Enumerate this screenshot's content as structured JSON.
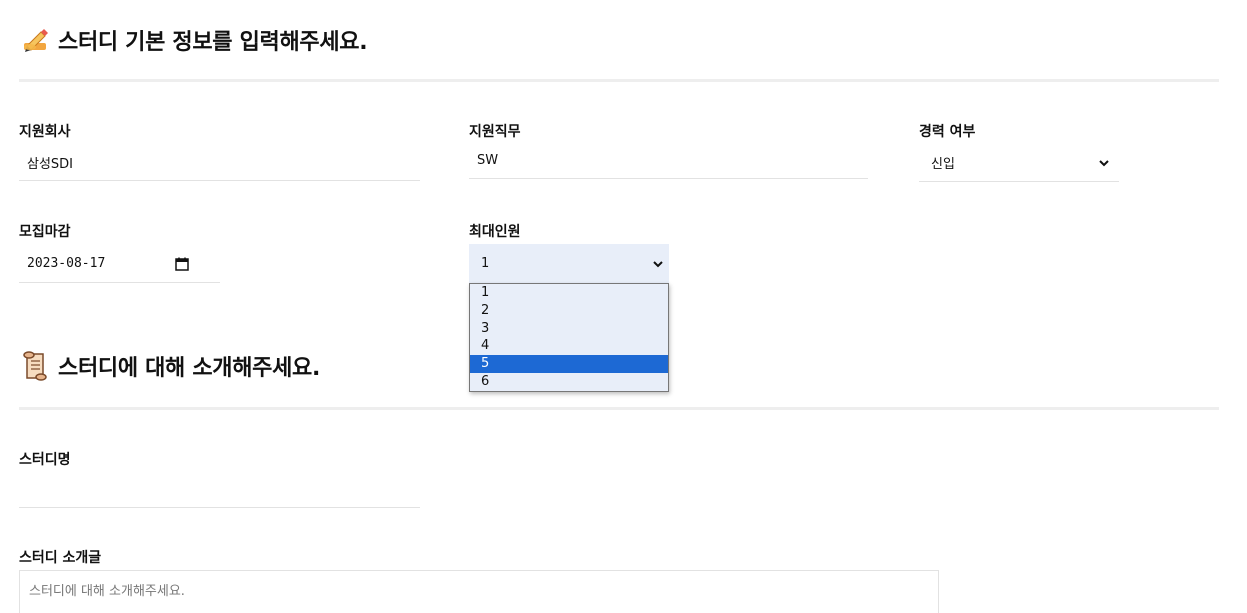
{
  "sections": {
    "basic": {
      "emoji": "✍️",
      "title": "스터디 기본 정보를 입력해주세요."
    },
    "intro": {
      "emoji": "📜",
      "title": "스터디에 대해 소개해주세요."
    }
  },
  "fields": {
    "company": {
      "label": "지원회사",
      "value": "삼성SDI"
    },
    "job": {
      "label": "지원직무",
      "value": "SW"
    },
    "career": {
      "label": "경력 여부",
      "value": "신입"
    },
    "deadline": {
      "label": "모집마감",
      "value": "2023-08-17"
    },
    "max_members": {
      "label": "최대인원",
      "value": "1",
      "options": [
        "1",
        "2",
        "3",
        "4",
        "5",
        "6"
      ],
      "highlighted": "5"
    },
    "study_name": {
      "label": "스터디명",
      "value": ""
    },
    "study_intro": {
      "label": "스터디 소개글",
      "placeholder": "스터디에 대해 소개해주세요."
    }
  },
  "icons": {
    "select_chevron": "chevron-down-icon",
    "calendar": "calendar-icon"
  }
}
